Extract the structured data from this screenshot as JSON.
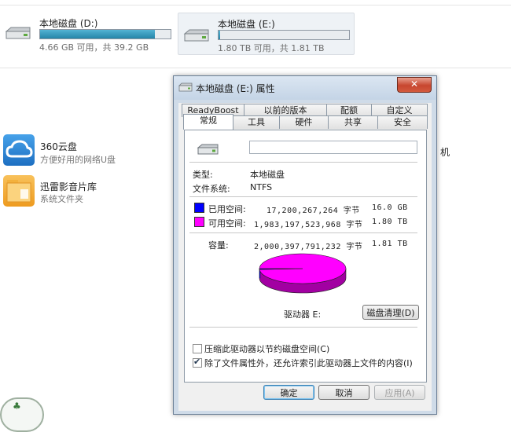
{
  "explorer": {
    "drives": [
      {
        "name": "本地磁盘 (D:)",
        "free_text": "4.66 GB 可用，共 39.2 GB",
        "used_fraction": 0.88
      },
      {
        "name": "本地磁盘 (E:)",
        "free_text": "1.80 TB 可用，共 1.81 TB",
        "used_fraction": 0.01
      }
    ],
    "apps": [
      {
        "title": "360云盘",
        "subtitle": "方便好用的网络U盘",
        "icon": "cloud-icon"
      },
      {
        "title": "迅雷影音片库",
        "subtitle": "系统文件夹",
        "icon": "folder-icon"
      }
    ],
    "partial_text": "机"
  },
  "dialog": {
    "title": "本地磁盘 (E:) 属性",
    "close_label": "✕",
    "tabs_row1": [
      "ReadyBoost",
      "以前的版本",
      "配额",
      "自定义"
    ],
    "tabs_row2": [
      "常规",
      "工具",
      "硬件",
      "共享",
      "安全"
    ],
    "active_tab": "常规",
    "drive_label_value": "",
    "type_label": "类型:",
    "type_value": "本地磁盘",
    "fs_label": "文件系统:",
    "fs_value": "NTFS",
    "used_label": "已用空间:",
    "used_bytes": "17,200,267,264 字节",
    "used_size": "16.0 GB",
    "free_label": "可用空间:",
    "free_bytes": "1,983,197,523,968 字节",
    "free_size": "1.80 TB",
    "capacity_label": "容量:",
    "capacity_bytes": "2,000,397,791,232 字节",
    "capacity_size": "1.81 TB",
    "drive_letter_label": "驱动器 E:",
    "cleanup_button": "磁盘清理(D)",
    "compress_label": "压缩此驱动器以节约磁盘空间(C)",
    "compress_checked": false,
    "index_label": "除了文件属性外，还允许索引此驱动器上文件的内容(I)",
    "index_checked": true,
    "ok_button": "确定",
    "cancel_button": "取消",
    "apply_button": "应用(A)",
    "colors": {
      "used": "#0000ff",
      "free": "#ff00ff"
    },
    "used_fraction": 0.0086
  }
}
